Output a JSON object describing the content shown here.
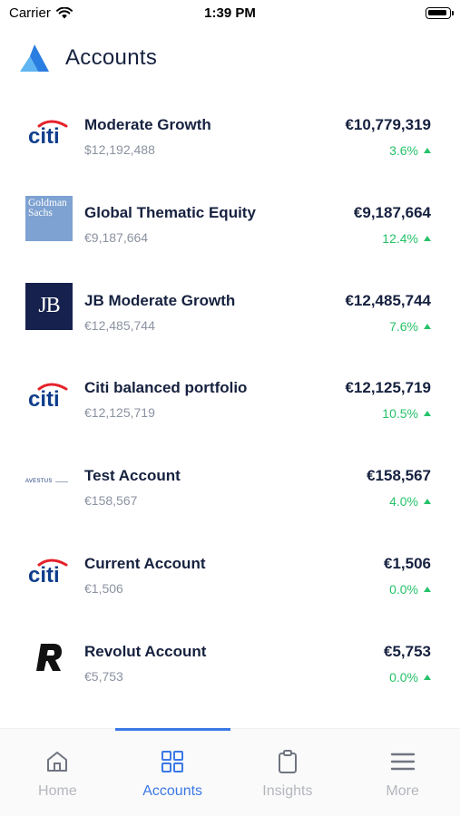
{
  "status_bar": {
    "carrier": "Carrier",
    "time": "1:39 PM"
  },
  "header": {
    "title": "Accounts",
    "logo": "brand-logo"
  },
  "accounts": [
    {
      "logo": "citi-logo",
      "name": "Moderate Growth",
      "sub": "$12,192,488",
      "value": "€10,779,319",
      "change": "3.6%"
    },
    {
      "logo": "goldman-sachs-logo",
      "logo_text": "Goldman Sachs",
      "name": "Global Thematic Equity",
      "sub": "€9,187,664",
      "value": "€9,187,664",
      "change": "12.4%"
    },
    {
      "logo": "jb-logo",
      "logo_text": "JB",
      "name": "JB Moderate Growth",
      "sub": "€12,485,744",
      "value": "€12,485,744",
      "change": "7.6%"
    },
    {
      "logo": "citi-logo",
      "name": "Citi balanced portfolio",
      "sub": "€12,125,719",
      "value": "€12,125,719",
      "change": "10.5%"
    },
    {
      "logo": "avestus-logo",
      "logo_text": "AVESTUS",
      "name": "Test Account",
      "sub": "€158,567",
      "value": "€158,567",
      "change": "4.0%"
    },
    {
      "logo": "citi-logo",
      "name": "Current Account",
      "sub": "€1,506",
      "value": "€1,506",
      "change": "0.0%"
    },
    {
      "logo": "revolut-logo",
      "name": "Revolut Account",
      "sub": "€5,753",
      "value": "€5,753",
      "change": "0.0%"
    }
  ],
  "tabs": [
    {
      "label": "Home",
      "icon": "home-icon",
      "active": false
    },
    {
      "label": "Accounts",
      "icon": "grid-icon",
      "active": true
    },
    {
      "label": "Insights",
      "icon": "clipboard-icon",
      "active": false
    },
    {
      "label": "More",
      "icon": "menu-icon",
      "active": false
    }
  ],
  "colors": {
    "accent": "#3b78e7",
    "positive": "#27c26a",
    "text_primary": "#16213f",
    "text_secondary": "#8b92a0",
    "tab_inactive": "#b4b7be"
  }
}
